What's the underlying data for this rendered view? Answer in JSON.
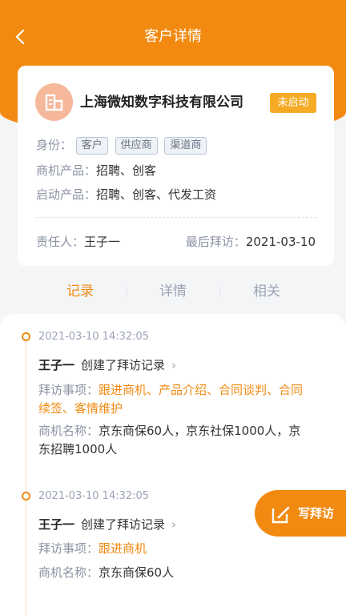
{
  "nav": {
    "title": "客户详情"
  },
  "customer": {
    "name": "上海微知数字科技有限公司",
    "status": "未启动",
    "identity_label": "身份：",
    "identity_tags": [
      "客户",
      "供应商",
      "渠道商"
    ],
    "opportunity_label": "商机产品：",
    "opportunity_products": "招聘、创客",
    "launch_label": "启动产品：",
    "launch_products": "招聘、创客、代发工资",
    "owner_label": "责任人：",
    "owner": "王子一",
    "last_visit_label": "最后拜访：",
    "last_visit": "2021-03-10"
  },
  "tabs": [
    "记录",
    "详情",
    "相关"
  ],
  "records": [
    {
      "time": "2021-03-10 14:32:05",
      "person": "王子一",
      "action": "创建了拜访记录",
      "item_label": "拜访事项：",
      "item_line1": "跟进商机、产品介绍、合同谈判、合同",
      "item_line2": "续签、客情维护",
      "opp_label": "商机名称：",
      "opp_line1": "京东商保60人，京东社保1000人，京",
      "opp_line2": "东招聘1000人"
    },
    {
      "time": "2021-03-10 14:32:05",
      "person": "王子一",
      "action": "创建了拜访记录",
      "item_label": "拜访事项：",
      "item_line1": "跟进商机",
      "opp_label": "商机名称：",
      "opp_line1": "京东商保60人"
    }
  ],
  "fab": {
    "label": "写拜访"
  },
  "colors": {
    "brand": "#f28a12",
    "status": "#f5ab25",
    "logo": "#f6b89b"
  },
  "icons": {
    "back": "chevron-left-icon",
    "logo": "building-icon",
    "fab": "edit-icon",
    "record_arrow": "chevron-right-icon"
  }
}
